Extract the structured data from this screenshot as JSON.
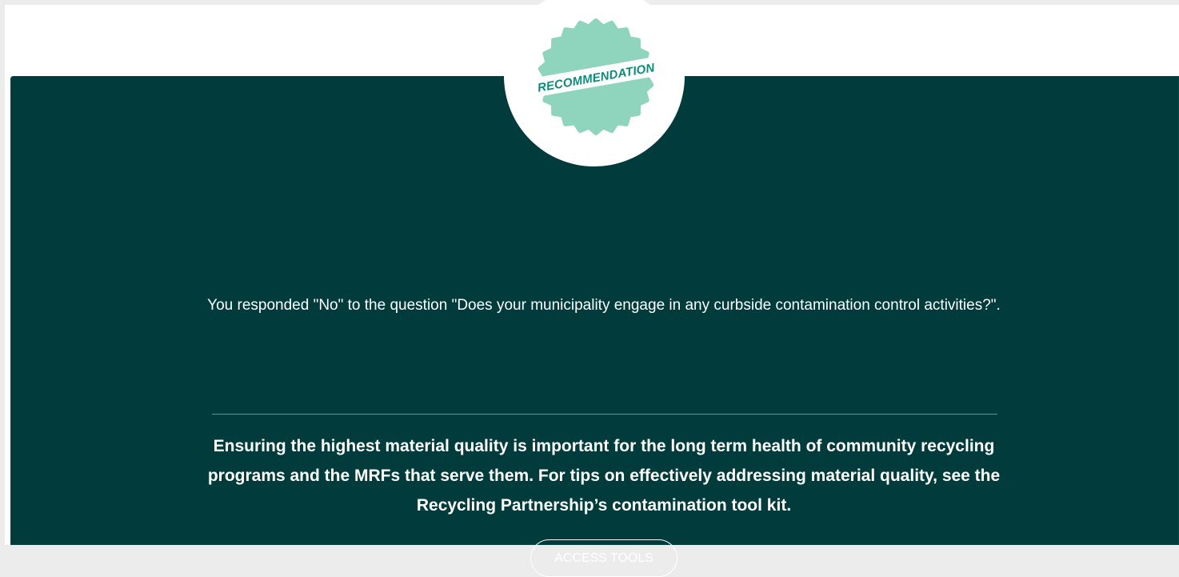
{
  "badge": {
    "label": "RECOMMENDATION",
    "icon": "seal-badge-icon",
    "colors": {
      "seal": "#8fd4bd",
      "ribbon": "#ffffff",
      "text": "#0c8a7a"
    }
  },
  "question": {
    "text": "You responded \"No\" to the question \"Does your municipality engage in any curbside contamination control activities?\"."
  },
  "recommendation": {
    "text": "Ensuring the highest material quality is important for the long term health of community recycling programs and the MRFs that serve them. For tips on effectively addressing material quality, see the Recycling Partnership’s contamination tool kit."
  },
  "actions": {
    "access_tools_label": "ACCESS TOOLS"
  },
  "theme": {
    "card_background": "#013b3b",
    "text_color": "#ffffff",
    "divider_color": "#6d8e8e"
  }
}
